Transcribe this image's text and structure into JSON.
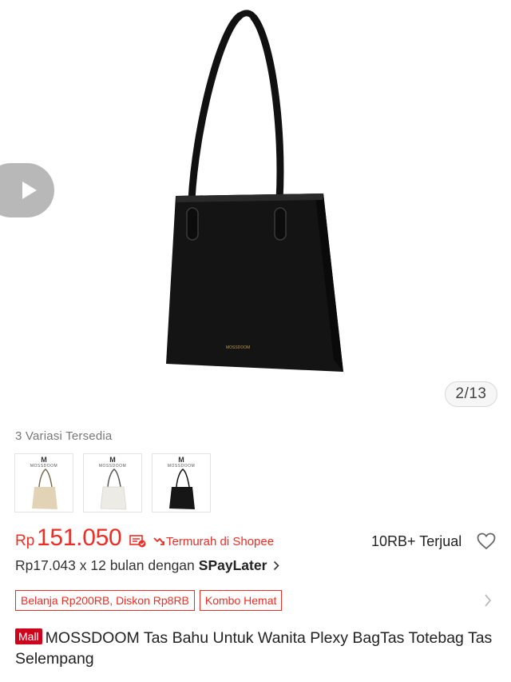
{
  "gallery": {
    "counter": "2/13",
    "photo_brand": "MOSSDOOM"
  },
  "variants": {
    "label": "3 Variasi Tersedia",
    "items": [
      {
        "brand": "MOSSDOOM",
        "color": "#e3d3b6"
      },
      {
        "brand": "MOSSDOOM",
        "color": "#ecebe6"
      },
      {
        "brand": "MOSSDOOM",
        "color": "#161616"
      }
    ]
  },
  "price": {
    "currency": "Rp",
    "amount": "151.050",
    "cheapest_label": "Termurah di Shopee",
    "sold": "10RB+ Terjual"
  },
  "installment": {
    "text": "Rp17.043 x 12 bulan dengan",
    "provider": "SPayLater"
  },
  "vouchers": [
    "Belanja Rp200RB, Diskon Rp8RB",
    "Kombo Hemat"
  ],
  "product": {
    "badge": "Mall",
    "title": "MOSSDOOM Tas Bahu Untuk Wanita Plexy BagTas Totebag  Tas Selempang"
  },
  "colors": {
    "accent": "#ee2d24",
    "mall_badge": "#d0011b"
  }
}
